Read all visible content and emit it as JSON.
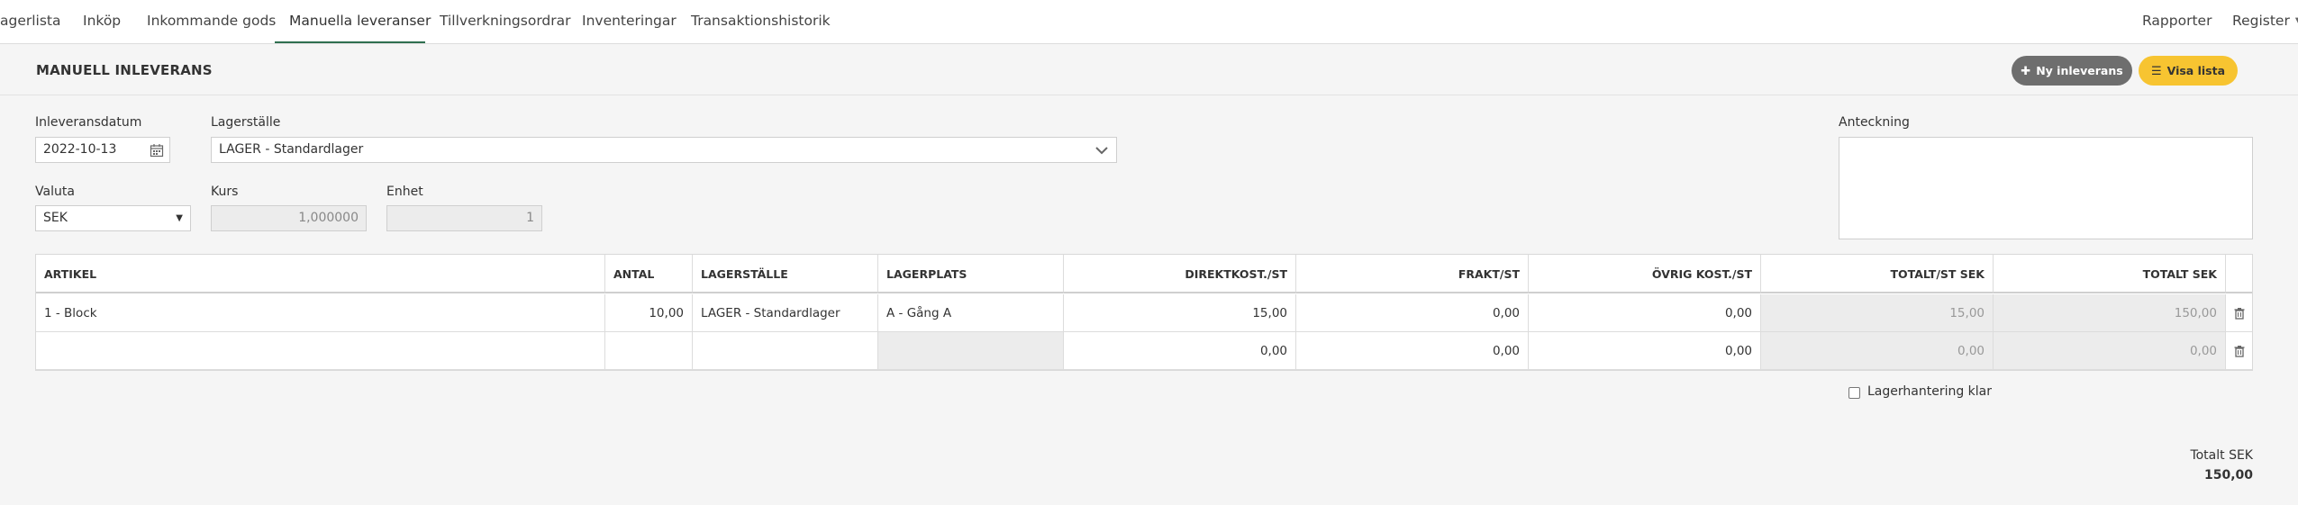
{
  "nav": {
    "tabs": [
      {
        "label": "agerlista"
      },
      {
        "label": "Inköp"
      },
      {
        "label": "Inkommande gods"
      },
      {
        "label": "Manuella leveranser"
      },
      {
        "label": "Tillverkningsordrar"
      },
      {
        "label": "Inventeringar"
      },
      {
        "label": "Transaktionshistorik"
      }
    ],
    "reports": "Rapporter",
    "register": "Register"
  },
  "page": {
    "title": "MANUELL INLEVERANS",
    "new_button": "Ny inleverans",
    "list_button": "Visa lista"
  },
  "form": {
    "date_label": "Inleveransdatum",
    "date_value": "2022-10-13",
    "location_label": "Lagerställe",
    "location_value": "LAGER - Standardlager",
    "note_label": "Anteckning",
    "currency_label": "Valuta",
    "currency_value": "SEK",
    "rate_label": "Kurs",
    "rate_value": "1,000000",
    "unit_label": "Enhet",
    "unit_value": "1"
  },
  "table": {
    "columns": [
      "ARTIKEL",
      "ANTAL",
      "LAGERSTÄLLE",
      "LAGERPLATS",
      "DIREKTKOST./ST",
      "FRAKT/ST",
      "ÖVRIG KOST./ST",
      "TOTALT/ST SEK",
      "TOTALT SEK"
    ],
    "rows": [
      [
        "1 - Block",
        "10,00",
        "LAGER - Standardlager",
        "A - Gång A",
        "15,00",
        "0,00",
        "0,00",
        "15,00",
        "150,00"
      ],
      [
        "",
        "",
        "",
        "",
        "0,00",
        "0,00",
        "0,00",
        "0,00",
        "0,00"
      ]
    ]
  },
  "stock_done_label": "Lagerhantering klar",
  "total": {
    "label": "Totalt SEK",
    "value": "150,00"
  },
  "colors": {
    "accent_green": "#2e6f4f",
    "button_gray": "#6e6e6e",
    "button_yellow": "#f7c431"
  }
}
